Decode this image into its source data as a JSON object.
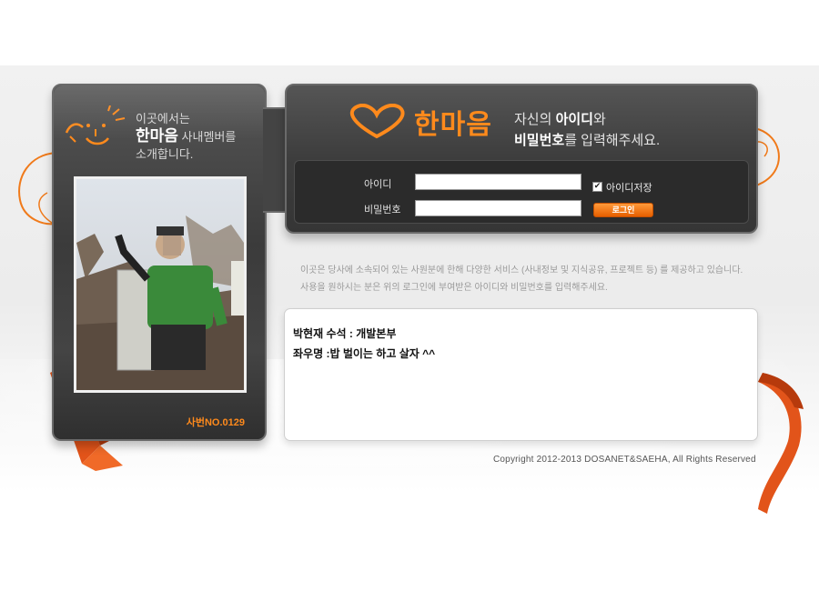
{
  "intro": {
    "line1": "이곳에서는",
    "brand": "한마음",
    "line2_suffix": " 사내멤버를",
    "line3": "소개합니다."
  },
  "employee": {
    "number": "사번NO.0129"
  },
  "header": {
    "logo": "한마음",
    "tagline_pre": "자신의 ",
    "tagline_id": "아이디",
    "tagline_mid": "와",
    "tagline_pw": "비밀번호",
    "tagline_post": "를 입력해주세요."
  },
  "login_form": {
    "id_label": "아이디",
    "id_value": "",
    "password_label": "비밀번호",
    "password_value": "",
    "remember_label": "아이디저장",
    "remember_checked": "✔",
    "login_button": "로그인"
  },
  "description": {
    "line1": "이곳은 당사에 소속되어 있는 사원분에 한해 다양한 서비스 (사내정보 및 지식공유, 프로젝트 등) 를 제공하고 있습니다.",
    "line2": "사용을 원하시는 분은 위의 로그인에 부여받은 아이디와 비밀번호를 입력해주세요."
  },
  "profile": {
    "name_line": "박현재 수석 : 개발본부",
    "motto_line": "좌우명 :밥 벌이는 하고 살자 ^^"
  },
  "footer": {
    "copyright": "Copyright 2012-2013 DOSANET&SAEHA, All Rights Reserved"
  },
  "colors": {
    "accent": "#ff8a1c",
    "card_dark": "#3d3d3d",
    "ribbon": "#e2541a"
  }
}
